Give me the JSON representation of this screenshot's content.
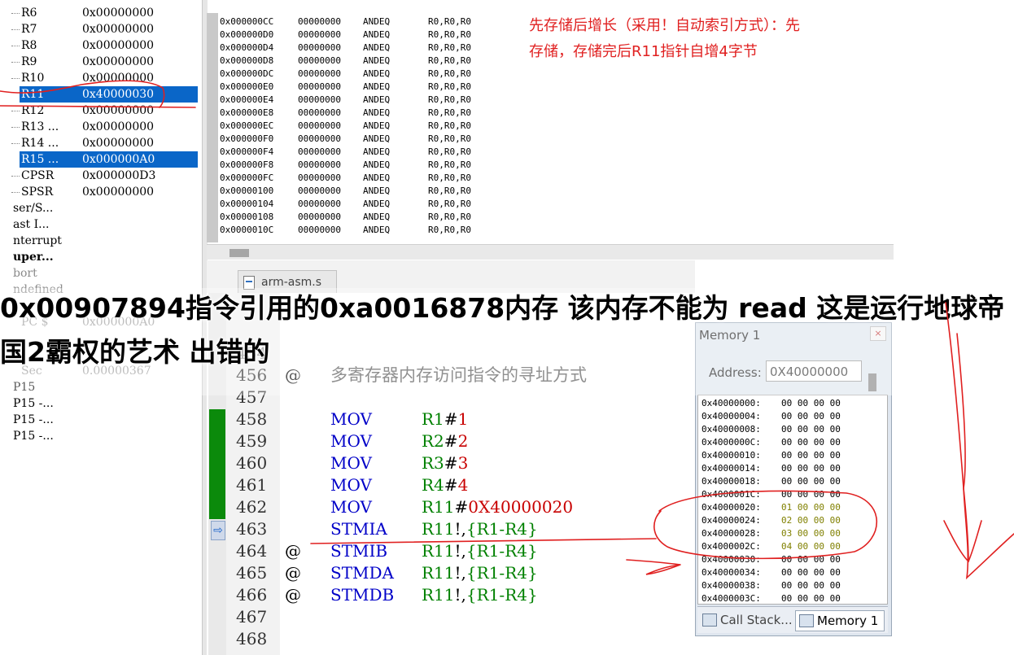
{
  "registers": [
    {
      "name": "R6",
      "value": "0x00000000"
    },
    {
      "name": "R7",
      "value": "0x00000000"
    },
    {
      "name": "R8",
      "value": "0x00000000"
    },
    {
      "name": "R9",
      "value": "0x00000000"
    },
    {
      "name": "R10",
      "value": "0x00000000"
    },
    {
      "name": "R11",
      "value": "0x40000030"
    },
    {
      "name": "R12",
      "value": "0x00000000"
    },
    {
      "name": "R13 ...",
      "value": "0x00000000"
    },
    {
      "name": "R14 ...",
      "value": "0x00000000"
    },
    {
      "name": "R15 ...",
      "value": "0x000000A0"
    },
    {
      "name": "CPSR",
      "value": "0x000000D3"
    },
    {
      "name": "SPSR",
      "value": "0x00000000"
    }
  ],
  "modes": [
    "ser/S...",
    "ast I...",
    "nterrupt",
    "uper...",
    "bort",
    "ndefined"
  ],
  "extra_rows": [
    {
      "name": "PC  $",
      "value": "0x000000A0"
    },
    {
      "name": "Sec",
      "value": "0.00000367"
    }
  ],
  "p15_rows": [
    "P15",
    "P15 -...",
    "P15 -...",
    "P15 -..."
  ],
  "disassembly": [
    {
      "addr": "0x000000CC",
      "code": "00000000",
      "mn": "ANDEQ",
      "ops": "R0,R0,R0"
    },
    {
      "addr": "0x000000D0",
      "code": "00000000",
      "mn": "ANDEQ",
      "ops": "R0,R0,R0"
    },
    {
      "addr": "0x000000D4",
      "code": "00000000",
      "mn": "ANDEQ",
      "ops": "R0,R0,R0"
    },
    {
      "addr": "0x000000D8",
      "code": "00000000",
      "mn": "ANDEQ",
      "ops": "R0,R0,R0"
    },
    {
      "addr": "0x000000DC",
      "code": "00000000",
      "mn": "ANDEQ",
      "ops": "R0,R0,R0"
    },
    {
      "addr": "0x000000E0",
      "code": "00000000",
      "mn": "ANDEQ",
      "ops": "R0,R0,R0"
    },
    {
      "addr": "0x000000E4",
      "code": "00000000",
      "mn": "ANDEQ",
      "ops": "R0,R0,R0"
    },
    {
      "addr": "0x000000E8",
      "code": "00000000",
      "mn": "ANDEQ",
      "ops": "R0,R0,R0"
    },
    {
      "addr": "0x000000EC",
      "code": "00000000",
      "mn": "ANDEQ",
      "ops": "R0,R0,R0"
    },
    {
      "addr": "0x000000F0",
      "code": "00000000",
      "mn": "ANDEQ",
      "ops": "R0,R0,R0"
    },
    {
      "addr": "0x000000F4",
      "code": "00000000",
      "mn": "ANDEQ",
      "ops": "R0,R0,R0"
    },
    {
      "addr": "0x000000F8",
      "code": "00000000",
      "mn": "ANDEQ",
      "ops": "R0,R0,R0"
    },
    {
      "addr": "0x000000FC",
      "code": "00000000",
      "mn": "ANDEQ",
      "ops": "R0,R0,R0"
    },
    {
      "addr": "0x00000100",
      "code": "00000000",
      "mn": "ANDEQ",
      "ops": "R0,R0,R0"
    },
    {
      "addr": "0x00000104",
      "code": "00000000",
      "mn": "ANDEQ",
      "ops": "R0,R0,R0"
    },
    {
      "addr": "0x00000108",
      "code": "00000000",
      "mn": "ANDEQ",
      "ops": "R0,R0,R0"
    },
    {
      "addr": "0x0000010C",
      "code": "00000000",
      "mn": "ANDEQ",
      "ops": "R0,R0,R0"
    }
  ],
  "annotation": {
    "line1": "先存储后增长（采用！自动索引方式）：先",
    "line2": "存储，存储完后R11指针自增4字节"
  },
  "editor": {
    "tab_label": "arm-asm.s",
    "lines": [
      {
        "n": "456",
        "at": "@",
        "comment": "多寄存器内存访问指令的寻址方式"
      },
      {
        "n": "457"
      },
      {
        "n": "458",
        "op": "MOV",
        "a": "R1",
        "b": "#",
        "c": "1"
      },
      {
        "n": "459",
        "op": "MOV",
        "a": "R2",
        "b": "#",
        "c": "2"
      },
      {
        "n": "460",
        "op": "MOV",
        "a": "R3",
        "b": "#",
        "c": "3"
      },
      {
        "n": "461",
        "op": "MOV",
        "a": "R4",
        "b": "#",
        "c": "4"
      },
      {
        "n": "462",
        "op": "MOV",
        "a": "R11",
        "b": "#",
        "c": "0X40000020"
      },
      {
        "n": "463",
        "op": "STMIA",
        "a": "R11",
        "b": "!,",
        "c": "{R1-R4}"
      },
      {
        "n": "464",
        "at": "@",
        "op": "STMIB",
        "a": "R11",
        "b": "!,",
        "c": "{R1-R4}"
      },
      {
        "n": "465",
        "at": "@",
        "op": "STMDA",
        "a": "R11",
        "b": "!,",
        "c": "{R1-R4}"
      },
      {
        "n": "466",
        "at": "@",
        "op": "STMDB",
        "a": "R11",
        "b": "!,",
        "c": "{R1-R4}"
      },
      {
        "n": "467"
      },
      {
        "n": "468"
      }
    ],
    "partial_line": "454"
  },
  "memory": {
    "title": "Memory 1",
    "address_label": "Address:",
    "address_value": "0X40000000",
    "close": "×",
    "rows": [
      {
        "addr": "0x40000000:",
        "bytes": "00 00 00 00"
      },
      {
        "addr": "0x40000004:",
        "bytes": "00 00 00 00"
      },
      {
        "addr": "0x40000008:",
        "bytes": "00 00 00 00"
      },
      {
        "addr": "0x4000000C:",
        "bytes": "00 00 00 00"
      },
      {
        "addr": "0x40000010:",
        "bytes": "00 00 00 00"
      },
      {
        "addr": "0x40000014:",
        "bytes": "00 00 00 00"
      },
      {
        "addr": "0x40000018:",
        "bytes": "00 00 00 00"
      },
      {
        "addr": "0x4000001C:",
        "bytes": "00 00 00 00"
      },
      {
        "addr": "0x40000020:",
        "bytes": "01 00 00 00"
      },
      {
        "addr": "0x40000024:",
        "bytes": "02 00 00 00"
      },
      {
        "addr": "0x40000028:",
        "bytes": "03 00 00 00"
      },
      {
        "addr": "0x4000002C:",
        "bytes": "04 00 00 00"
      },
      {
        "addr": "0x40000030:",
        "bytes": "00 00 00 00"
      },
      {
        "addr": "0x40000034:",
        "bytes": "00 00 00 00"
      },
      {
        "addr": "0x40000038:",
        "bytes": "00 00 00 00"
      },
      {
        "addr": "0x4000003C:",
        "bytes": "00 00 00 00"
      }
    ],
    "tabs": [
      "Call Stack...",
      "Memory 1"
    ]
  },
  "headline": "0x00907894指令引用的0xa0016878内存 该内存不能为 read 这是运行地球帝国2霸权的艺术 出错的",
  "colors": {
    "selection": "#0a66c8",
    "annotation": "#e02020",
    "mnemonic": "#0000c8",
    "register": "#008000",
    "immediate": "#c80000",
    "breakpoint_mark": "#0b8a0b"
  }
}
